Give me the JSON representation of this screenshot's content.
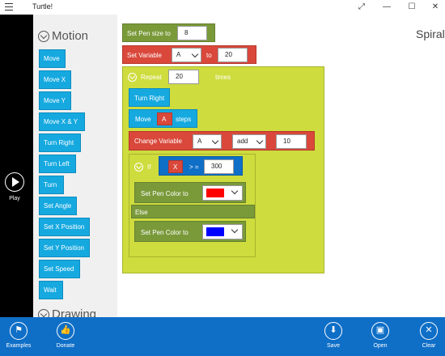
{
  "window": {
    "title": "Turtle!",
    "controls": {
      "expand": "⤢",
      "minimize": "—",
      "maximize": "☐",
      "close": "✕"
    }
  },
  "play": {
    "label": "Play",
    "icon": "play-icon"
  },
  "palette": {
    "category_motion": "Motion",
    "category_drawing": "Drawing",
    "motion_items": [
      "Move",
      "Move X",
      "Move Y",
      "Move X & Y",
      "Turn Right",
      "Turn Left",
      "Turn",
      "Set Angle",
      "Set X Position",
      "Set Y Position",
      "Set Speed",
      "Wait"
    ]
  },
  "project": {
    "name": "Spiral"
  },
  "program": {
    "set_pen_size": {
      "label": "Set Pen size to",
      "value": "8"
    },
    "set_variable": {
      "label": "Set Variable",
      "variable": "A",
      "to_label": "to",
      "value": "20"
    },
    "repeat": {
      "label": "Repeat",
      "count": "20",
      "suffix": "times"
    },
    "turn_right": {
      "label": "Turn Right"
    },
    "move": {
      "label": "Move",
      "variable": "A",
      "suffix": "steps"
    },
    "change_variable": {
      "label": "Change Variable",
      "variable": "A",
      "operation": "add",
      "value": "10"
    },
    "if_block": {
      "label": "If",
      "left": "X",
      "operator": "> =",
      "right": "300"
    },
    "pen_color_then": {
      "label": "Set Pen Color to",
      "color": "#ff0000"
    },
    "else_label": "Else",
    "pen_color_else": {
      "label": "Set Pen Color to",
      "color": "#0000ff"
    }
  },
  "appbar": {
    "examples": "Examples",
    "donate": "Donate",
    "save": "Save",
    "open": "Open",
    "clear": "Clear"
  },
  "colors": {
    "accent_blue": "#0f6fc7",
    "palette_blue": "#16a9e0",
    "olive": "#7a9a3a",
    "red": "#d9483b",
    "lime": "#cedc3e"
  }
}
